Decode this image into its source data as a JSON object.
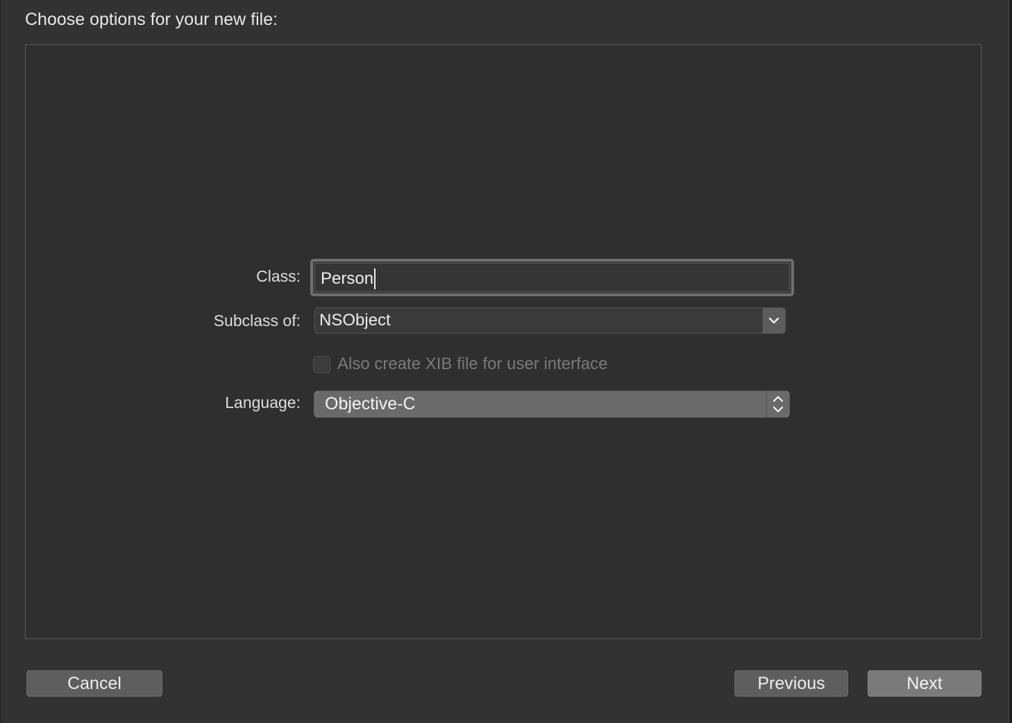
{
  "dialog": {
    "heading": "Choose options for your new file:"
  },
  "form": {
    "class_label": "Class:",
    "class_value": "Person",
    "subclass_label": "Subclass of:",
    "subclass_value": "NSObject",
    "xib_checkbox_label": "Also create XIB file for user interface",
    "xib_checkbox_checked": false,
    "xib_checkbox_enabled": false,
    "language_label": "Language:",
    "language_value": "Objective-C"
  },
  "buttons": {
    "cancel": "Cancel",
    "previous": "Previous",
    "next": "Next"
  },
  "icons": {
    "subclass_dropdown": "chevron-down-icon",
    "language_popup": "up-down-chevron-icon"
  }
}
